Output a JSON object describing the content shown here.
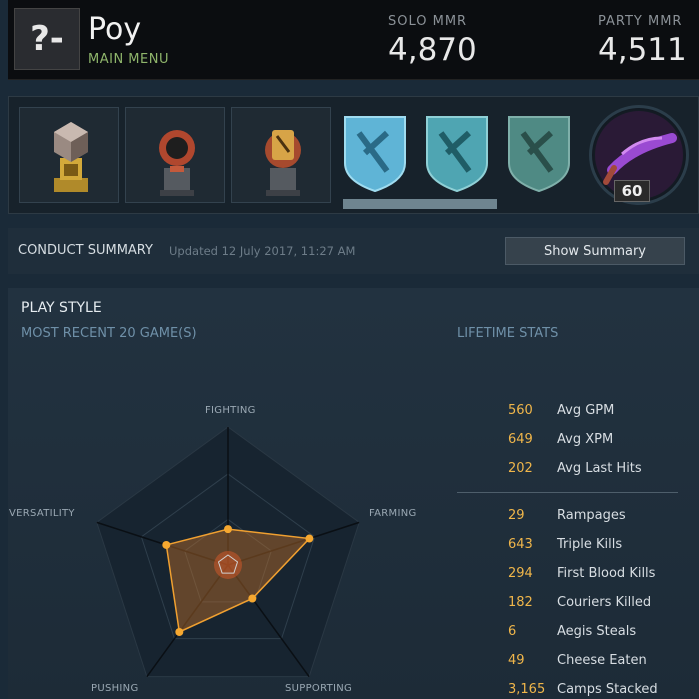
{
  "header": {
    "player_name": "Poy",
    "subtitle": "MAIN MENU",
    "solo_mmr_label": "SOLO MMR",
    "solo_mmr_value": "4,870",
    "party_mmr_label": "PARTY MMR",
    "party_mmr_value": "4,511"
  },
  "trophies": {
    "level": "60",
    "badge_progress": 0.55
  },
  "conduct": {
    "title": "CONDUCT SUMMARY",
    "updated": "Updated 12 July 2017, 11:27 AM",
    "button_label": "Show Summary"
  },
  "playstyle": {
    "title": "PLAY STYLE",
    "subtitle": "MOST RECENT 20 GAME(S)",
    "lifetime_title": "LIFETIME STATS",
    "axes": [
      "FIGHTING",
      "FARMING",
      "SUPPORTING",
      "PUSHING",
      "VERSATILITY"
    ],
    "radar_values": [
      0.26,
      0.62,
      0.3,
      0.6,
      0.47
    ],
    "stats_top": [
      {
        "value": "560",
        "label": "Avg GPM"
      },
      {
        "value": "649",
        "label": "Avg XPM"
      },
      {
        "value": "202",
        "label": "Avg Last Hits"
      }
    ],
    "stats_bottom": [
      {
        "value": "29",
        "label": "Rampages"
      },
      {
        "value": "643",
        "label": "Triple Kills"
      },
      {
        "value": "294",
        "label": "First Blood Kills"
      },
      {
        "value": "182",
        "label": "Couriers Killed"
      },
      {
        "value": "6",
        "label": "Aegis Steals"
      },
      {
        "value": "49",
        "label": "Cheese Eaten"
      },
      {
        "value": "3,165",
        "label": "Camps Stacked"
      }
    ]
  },
  "colors": {
    "accent_orange": "#f0b64a",
    "green_subtitle": "#8fb56b"
  }
}
